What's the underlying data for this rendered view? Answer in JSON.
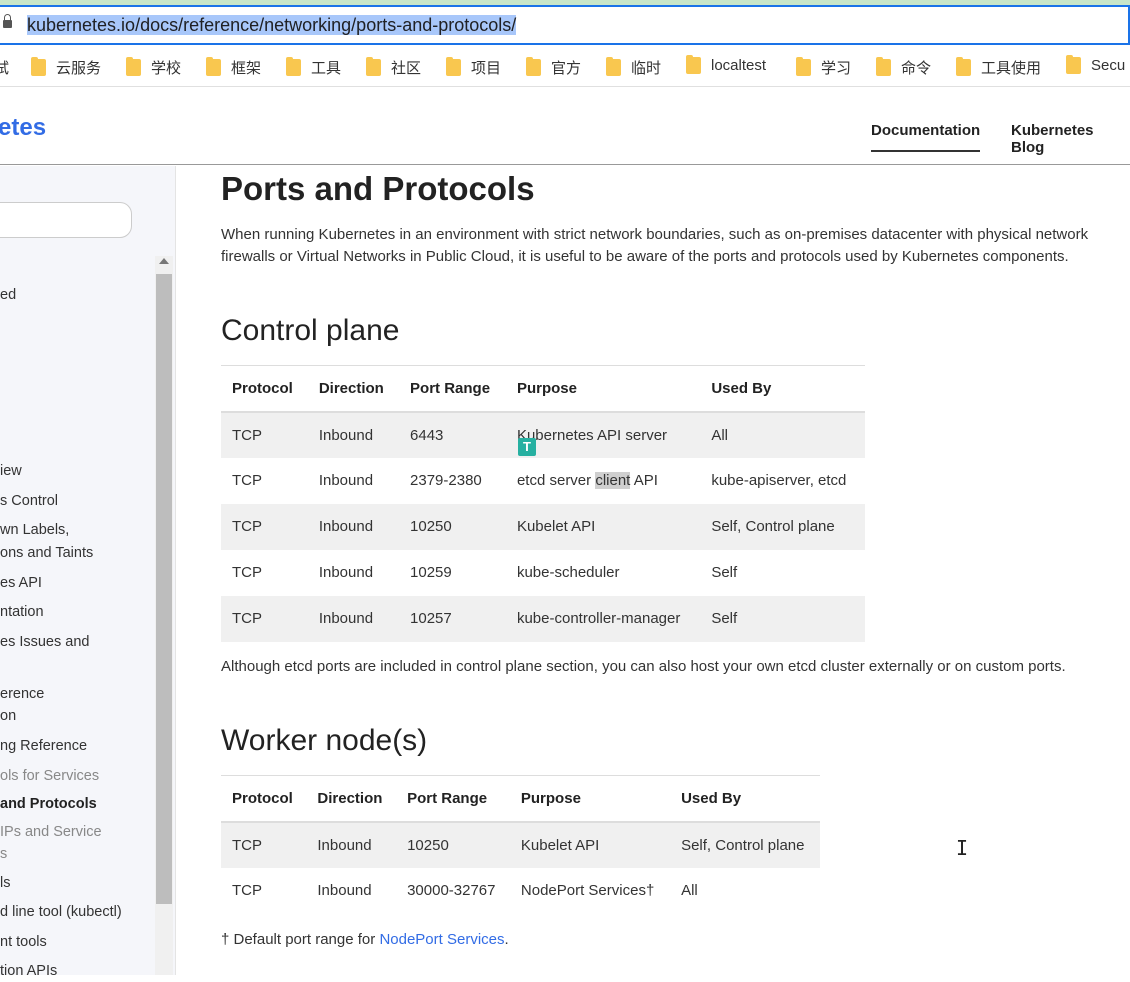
{
  "browser": {
    "url": "kubernetes.io/docs/reference/networking/ports-and-protocols/"
  },
  "bookmarks": [
    {
      "label": "试"
    },
    {
      "label": "云服务"
    },
    {
      "label": "学校"
    },
    {
      "label": "框架"
    },
    {
      "label": "工具"
    },
    {
      "label": "社区"
    },
    {
      "label": "项目"
    },
    {
      "label": "官方"
    },
    {
      "label": "临时"
    },
    {
      "label": "localtest"
    },
    {
      "label": "学习"
    },
    {
      "label": "命令"
    },
    {
      "label": "工具使用"
    },
    {
      "label": "Secu"
    }
  ],
  "header": {
    "brand": "etes",
    "nav": [
      {
        "label": "Documentation",
        "active": true
      },
      {
        "label": "Kubernetes Blog"
      }
    ]
  },
  "sidebar": {
    "items": [
      {
        "label": "ed"
      },
      {
        "label": "iew"
      },
      {
        "label": "s Control"
      },
      {
        "label": "wn Labels,"
      },
      {
        "label": "ons and Taints"
      },
      {
        "label": "es API"
      },
      {
        "label": "ntation"
      },
      {
        "label": "es Issues and"
      },
      {
        "label": "erence"
      },
      {
        "label": "on"
      },
      {
        "label": "ng Reference"
      },
      {
        "label": "ols for Services"
      },
      {
        "label": "and Protocols"
      },
      {
        "label": "IPs and Service"
      },
      {
        "label": "s"
      },
      {
        "label": "ls"
      },
      {
        "label": "d line tool (kubectl)"
      },
      {
        "label": "nt tools"
      },
      {
        "label": "tion APIs"
      }
    ]
  },
  "main": {
    "title": "Ports and Protocols",
    "intro_line1": "When running Kubernetes in an environment with strict network boundaries, such as on-premises datacenter with physical network",
    "intro_line2": "firewalls or Virtual Networks in Public Cloud, it is useful to be aware of the ports and protocols used by Kubernetes components.",
    "control_plane": {
      "heading": "Control plane",
      "columns": [
        "Protocol",
        "Direction",
        "Port Range",
        "Purpose",
        "Used By"
      ],
      "rows": [
        [
          "TCP",
          "Inbound",
          "6443",
          "Kubernetes API server",
          "All"
        ],
        [
          "TCP",
          "Inbound",
          "2379-2380",
          "etcd server client API",
          "kube-apiserver, etcd"
        ],
        [
          "TCP",
          "Inbound",
          "10250",
          "Kubelet API",
          "Self, Control plane"
        ],
        [
          "TCP",
          "Inbound",
          "10259",
          "kube-scheduler",
          "Self"
        ],
        [
          "TCP",
          "Inbound",
          "10257",
          "kube-controller-manager",
          "Self"
        ]
      ],
      "note": "Although etcd ports are included in control plane section, you can also host your own etcd cluster externally or on custom ports."
    },
    "worker": {
      "heading": "Worker node(s)",
      "columns": [
        "Protocol",
        "Direction",
        "Port Range",
        "Purpose",
        "Used By"
      ],
      "rows": [
        [
          "TCP",
          "Inbound",
          "10250",
          "Kubelet API",
          "Self, Control plane"
        ],
        [
          "TCP",
          "Inbound",
          "30000-32767",
          "NodePort Services†",
          "All"
        ]
      ],
      "footnote_prefix": "† Default port range for ",
      "footnote_link": "NodePort Services",
      "footnote_suffix": "."
    },
    "purpose_split": {
      "before": "etcd server ",
      "highlight": "client",
      "after": " API"
    }
  },
  "overlay": {
    "translate_icon": "T"
  }
}
